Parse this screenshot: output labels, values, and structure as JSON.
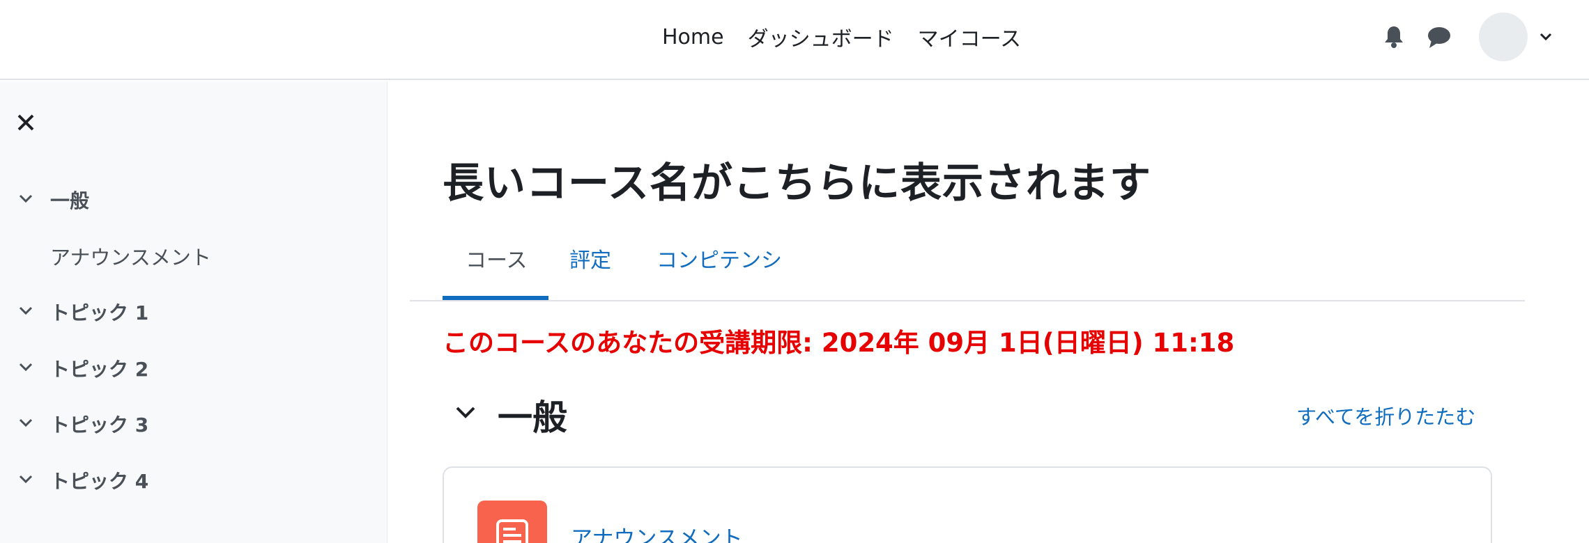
{
  "navbar": {
    "links": [
      "Home",
      "ダッシュボード",
      "マイコース"
    ],
    "icons": [
      "bell-icon",
      "chat-icon",
      "avatar",
      "chevron-down-icon"
    ]
  },
  "drawer": {
    "close_icon": "close-icon",
    "sections": [
      {
        "label": "一般",
        "expanded": true,
        "items": [
          "アナウンスメント"
        ]
      },
      {
        "label": "トピック 1",
        "expanded": true,
        "items": []
      },
      {
        "label": "トピック 2",
        "expanded": true,
        "items": []
      },
      {
        "label": "トピック 3",
        "expanded": true,
        "items": []
      },
      {
        "label": "トピック 4",
        "expanded": true,
        "items": []
      }
    ]
  },
  "main": {
    "course_title": "長いコース名がこちらに表示されます",
    "tabs": [
      {
        "label": "コース",
        "active": true
      },
      {
        "label": "評定",
        "active": false
      },
      {
        "label": "コンピテンシ",
        "active": false
      }
    ],
    "notice": "このコースのあなたの受講期限: 2024年 09月 1日(日曜日) 11:18",
    "section": {
      "title": "一般",
      "collapse_all": "すべてを折りたたむ",
      "activities": [
        {
          "name": "アナウンスメント",
          "icon": "forum-icon",
          "icon_color": "#f7634d"
        }
      ]
    }
  },
  "colors": {
    "link": "#0f6cbf",
    "notice": "#e60000",
    "drawer_bg": "#f8f9fa"
  }
}
